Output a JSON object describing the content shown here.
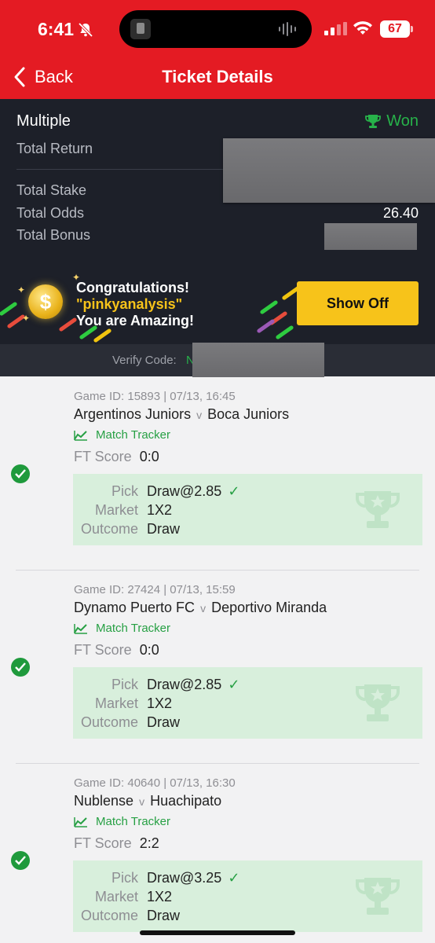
{
  "status_bar": {
    "time": "6:41",
    "battery": "67"
  },
  "nav": {
    "back_label": "Back",
    "title": "Ticket Details"
  },
  "summary": {
    "type": "Multiple",
    "status": "Won",
    "total_return_label": "Total Return",
    "total_stake_label": "Total Stake",
    "total_odds_label": "Total Odds",
    "total_odds_value": "26.40",
    "total_bonus_label": "Total Bonus"
  },
  "banner": {
    "line1": "Congratulations!",
    "line2": "\"pinkyanalysis\"",
    "line3": "You are Amazing!",
    "button_label": "Show Off"
  },
  "verify": {
    "label": "Verify Code:",
    "code_visible": "N"
  },
  "matches": [
    {
      "game_id": "Game ID: 15893 | 07/13, 16:45",
      "home": "Argentinos Juniors",
      "vs": "v",
      "away": "Boca Juniors",
      "tracker_label": "Match Tracker",
      "ft_label": "FT Score",
      "ft_value": "0:0",
      "pick_label": "Pick",
      "pick_value": "Draw@2.85",
      "market_label": "Market",
      "market_value": "1X2",
      "outcome_label": "Outcome",
      "outcome_value": "Draw"
    },
    {
      "game_id": "Game ID: 27424 | 07/13, 15:59",
      "home": "Dynamo Puerto FC",
      "vs": "v",
      "away": "Deportivo Miranda",
      "tracker_label": "Match Tracker",
      "ft_label": "FT Score",
      "ft_value": "0:0",
      "pick_label": "Pick",
      "pick_value": "Draw@2.85",
      "market_label": "Market",
      "market_value": "1X2",
      "outcome_label": "Outcome",
      "outcome_value": "Draw"
    },
    {
      "game_id": "Game ID: 40640 | 07/13, 16:30",
      "home": "Nublense",
      "vs": "v",
      "away": "Huachipato",
      "tracker_label": "Match Tracker",
      "ft_label": "FT Score",
      "ft_value": "2:2",
      "pick_label": "Pick",
      "pick_value": "Draw@3.25",
      "market_label": "Market",
      "market_value": "1X2",
      "outcome_label": "Outcome",
      "outcome_value": "Draw"
    }
  ],
  "colors": {
    "brand_red": "#e41b23",
    "won_green": "#27b24a",
    "accent_yellow": "#f7c31a",
    "dark_panel": "#1d2029"
  }
}
